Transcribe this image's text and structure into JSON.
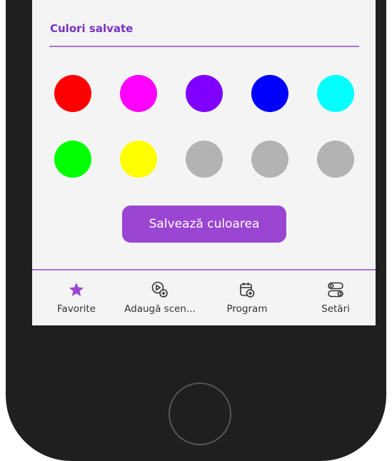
{
  "saved_colors": {
    "title": "Culori salvate",
    "swatches": [
      {
        "color": "#ff0000",
        "empty": false
      },
      {
        "color": "#ff00ff",
        "empty": false
      },
      {
        "color": "#8000ff",
        "empty": false
      },
      {
        "color": "#0000ff",
        "empty": false
      },
      {
        "color": "#00ffff",
        "empty": false
      },
      {
        "color": "#00ff00",
        "empty": false
      },
      {
        "color": "#ffff00",
        "empty": false
      },
      {
        "color": "#b3b3b3",
        "empty": true
      },
      {
        "color": "#b3b3b3",
        "empty": true
      },
      {
        "color": "#b3b3b3",
        "empty": true
      }
    ]
  },
  "save_button": {
    "label": "Salvează culoarea"
  },
  "tabs": [
    {
      "label": "Favorite",
      "icon": "star-icon",
      "active": true
    },
    {
      "label": "Adaugă scen...",
      "icon": "add-scene-icon",
      "active": false
    },
    {
      "label": "Program",
      "icon": "calendar-add-icon",
      "active": false
    },
    {
      "label": "Setări",
      "icon": "toggles-icon",
      "active": false
    }
  ],
  "colors": {
    "accent": "#9b46d2",
    "title": "#7a2fc0",
    "divider": "#a974d6",
    "screen_bg": "#f4f4f4",
    "phone_body": "#1f1f1f"
  }
}
